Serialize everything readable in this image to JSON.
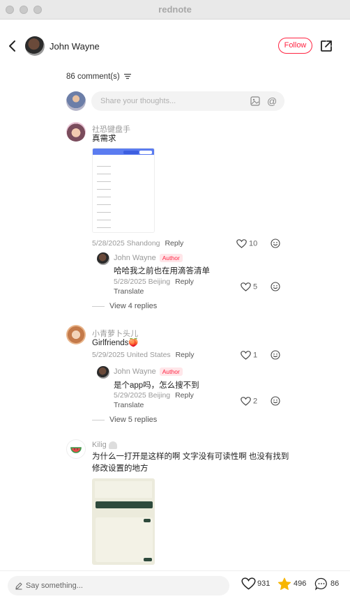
{
  "window": {
    "title": "rednote"
  },
  "header": {
    "author_name": "John Wayne",
    "follow_label": "Follow"
  },
  "comments_header": {
    "count_label": "86 comment(s)"
  },
  "composer": {
    "placeholder": "Share your thoughts..."
  },
  "comments": [
    {
      "name": "社恐键盘手",
      "text": "真需求",
      "meta": "5/28/2025 Shandong",
      "reply_label": "Reply",
      "likes": "10",
      "replies": [
        {
          "name": "John Wayne",
          "badge": "Author",
          "text": "哈哈我之前也在用滴答清单",
          "meta": "5/28/2025 Beijing",
          "reply_label": "Reply",
          "translate_label": "Translate",
          "likes": "5"
        }
      ],
      "view_replies": "View 4 replies"
    },
    {
      "name": "小青萝卜头儿",
      "text": "Girlfriends🍑",
      "meta": "5/29/2025 United States",
      "reply_label": "Reply",
      "likes": "1",
      "replies": [
        {
          "name": "John Wayne",
          "badge": "Author",
          "text": "是个app吗，怎么搜不到",
          "meta": "5/29/2025 Beijing",
          "reply_label": "Reply",
          "translate_label": "Translate",
          "likes": "2"
        }
      ],
      "view_replies": "View 5 replies"
    },
    {
      "name": "Kilig",
      "text_line1": "为什么一打开是这样的啊 文字没有可读性啊 也没有找到",
      "text_line2": "修改设置的地方"
    }
  ],
  "bottom_bar": {
    "placeholder": "Say something...",
    "likes": "931",
    "stars": "496",
    "comments": "86"
  },
  "colors": {
    "accent": "#ff2442",
    "star": "#f7b500"
  },
  "icons": [
    "back-icon",
    "share-icon",
    "sort-icon",
    "image-icon",
    "at-icon",
    "heart-icon",
    "emoji-icon",
    "pencil-icon",
    "star-icon",
    "comment-icon"
  ]
}
